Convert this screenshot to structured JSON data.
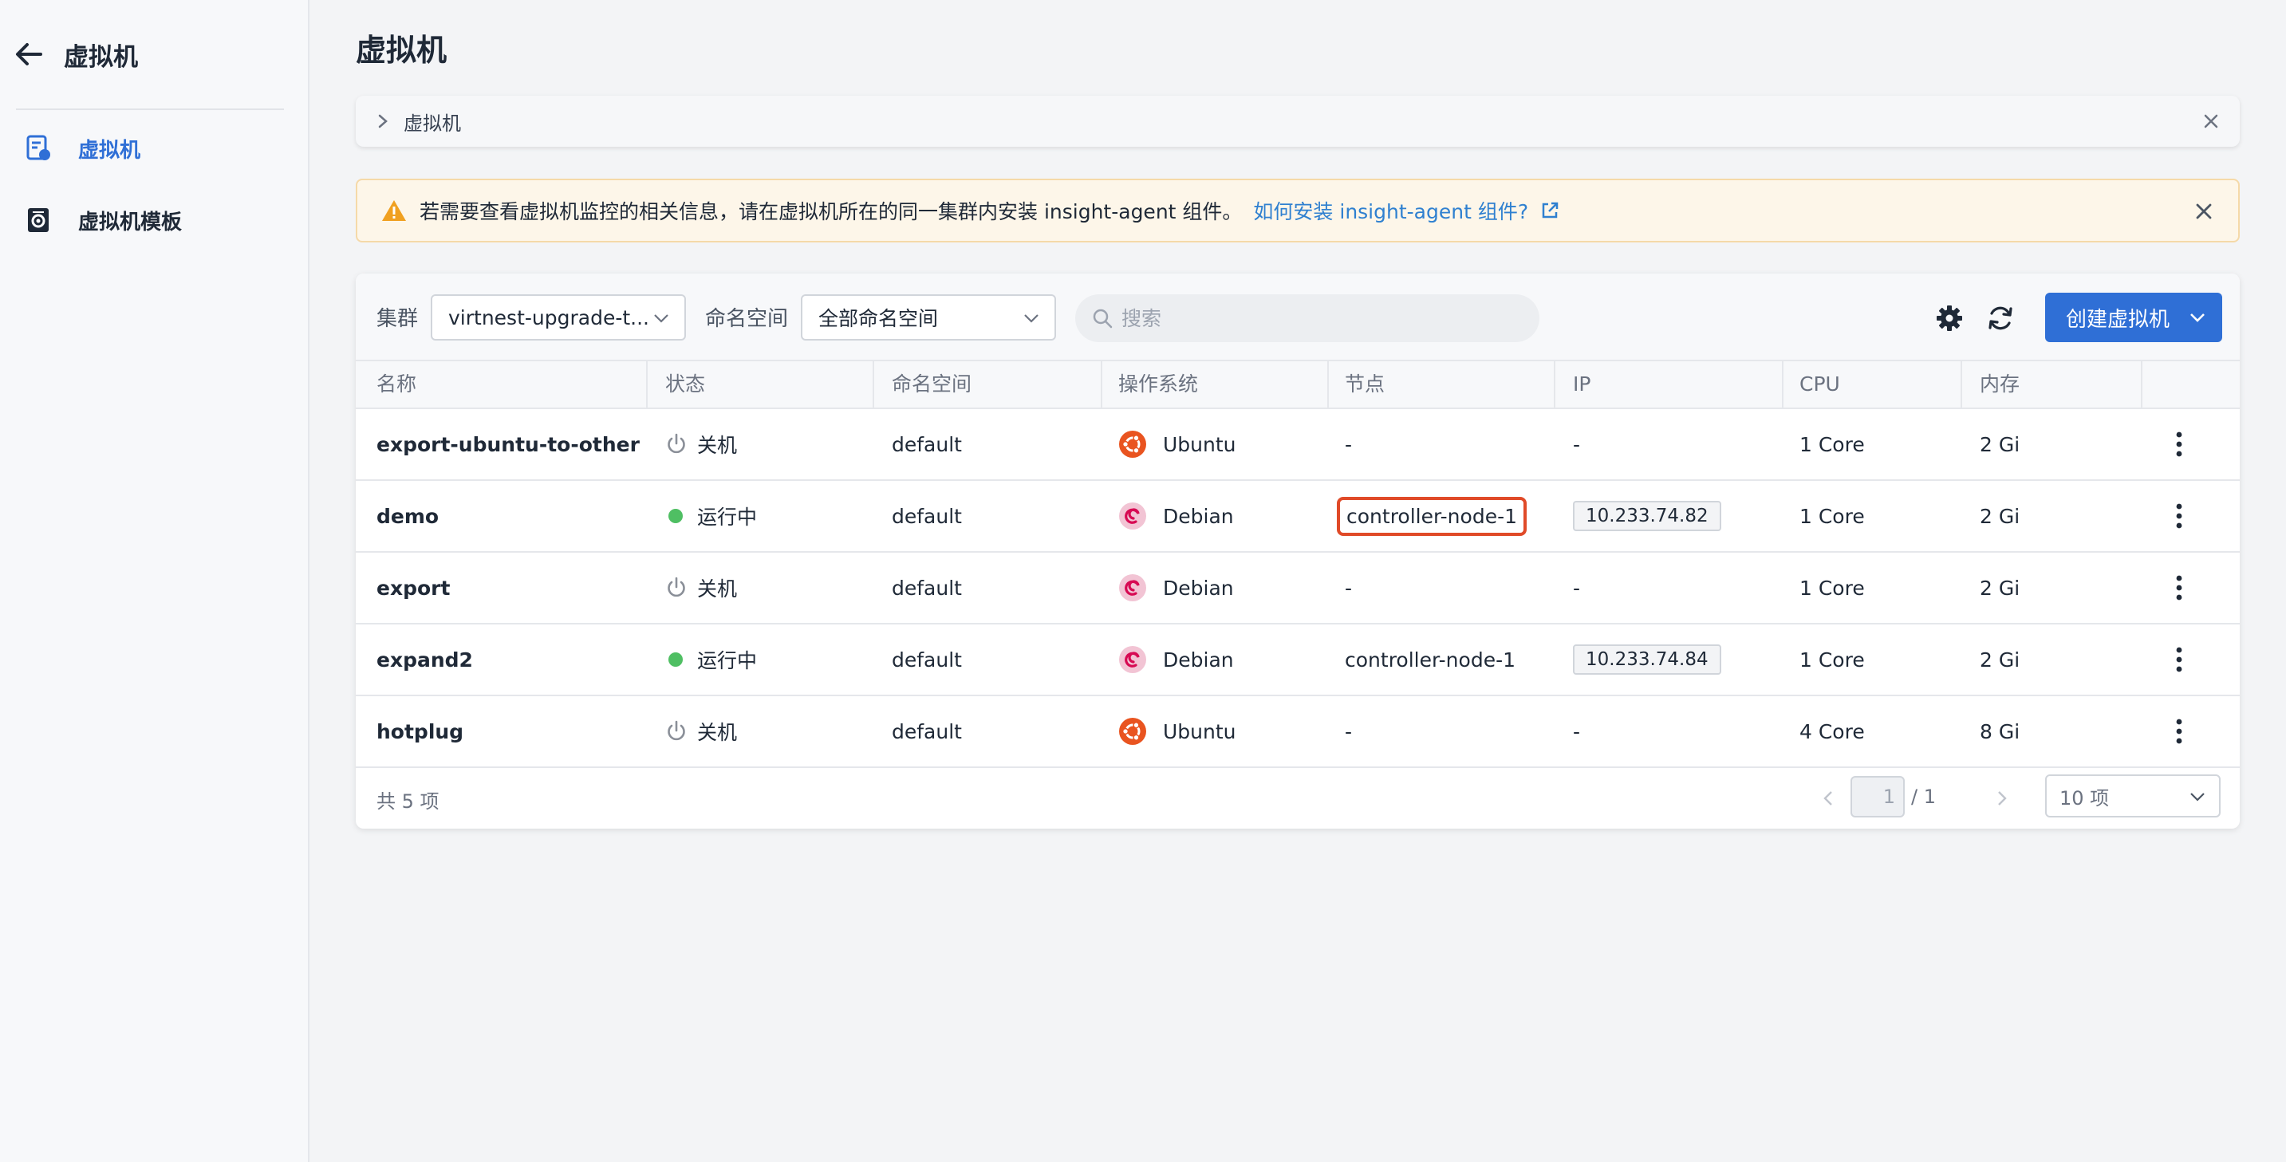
{
  "sidebar": {
    "title": "虚拟机",
    "items": [
      {
        "label": "虚拟机",
        "active": true,
        "icon": "vm-list-icon"
      },
      {
        "label": "虚拟机模板",
        "active": false,
        "icon": "vm-template-icon"
      }
    ]
  },
  "page": {
    "title": "虚拟机"
  },
  "breadcrumb": {
    "text": "虚拟机"
  },
  "alert": {
    "message": "若需要查看虚拟机监控的相关信息，请在虚拟机所在的同一集群内安装 insight-agent 组件。",
    "link_text": "如何安装 insight-agent 组件?"
  },
  "toolbar": {
    "cluster_label": "集群",
    "cluster_value": "virtnest-upgrade-t...",
    "namespace_label": "命名空间",
    "namespace_value": "全部命名空间",
    "search_placeholder": "搜索",
    "create_label": "创建虚拟机"
  },
  "table": {
    "columns": [
      "名称",
      "状态",
      "命名空间",
      "操作系统",
      "节点",
      "IP",
      "CPU",
      "内存"
    ],
    "rows": [
      {
        "name": "export-ubuntu-to-other",
        "status": "关机",
        "running": false,
        "namespace": "default",
        "os": "Ubuntu",
        "node": "-",
        "ip": "-",
        "cpu": "1 Core",
        "memory": "2 Gi"
      },
      {
        "name": "demo",
        "status": "运行中",
        "running": true,
        "namespace": "default",
        "os": "Debian",
        "node": "controller-node-1",
        "ip": "10.233.74.82",
        "cpu": "1 Core",
        "memory": "2 Gi"
      },
      {
        "name": "export",
        "status": "关机",
        "running": false,
        "namespace": "default",
        "os": "Debian",
        "node": "-",
        "ip": "-",
        "cpu": "1 Core",
        "memory": "2 Gi"
      },
      {
        "name": "expand2",
        "status": "运行中",
        "running": true,
        "namespace": "default",
        "os": "Debian",
        "node": "controller-node-1",
        "ip": "10.233.74.84",
        "cpu": "1 Core",
        "memory": "2 Gi"
      },
      {
        "name": "hotplug",
        "status": "关机",
        "running": false,
        "namespace": "default",
        "os": "Ubuntu",
        "node": "-",
        "ip": "-",
        "cpu": "4 Core",
        "memory": "8 Gi"
      }
    ]
  },
  "pagination": {
    "total": "共 5 项",
    "current": "1",
    "pages": "/ 1",
    "page_size": "10 项"
  },
  "colors": {
    "primary": "#2f6fd6",
    "running": "#4fbf63",
    "ubuntu": "#e95420",
    "debian": "#d70a53",
    "highlight": "#e04a28",
    "alert_bg": "#fdf6e9",
    "warning": "#f0a020"
  }
}
